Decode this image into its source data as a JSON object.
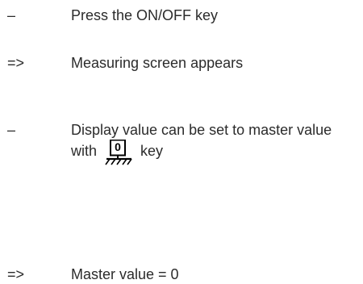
{
  "steps": [
    {
      "marker": "–",
      "text": "Press the ON/OFF key"
    },
    {
      "marker": "=>",
      "text": "Measuring screen appears"
    },
    {
      "marker": "–",
      "text_before": "Display value can be set to master value with",
      "key_label": "0",
      "icon": "zero-key-icon",
      "text_after": "key"
    },
    {
      "marker": "=>",
      "text": "Master value = 0"
    }
  ]
}
